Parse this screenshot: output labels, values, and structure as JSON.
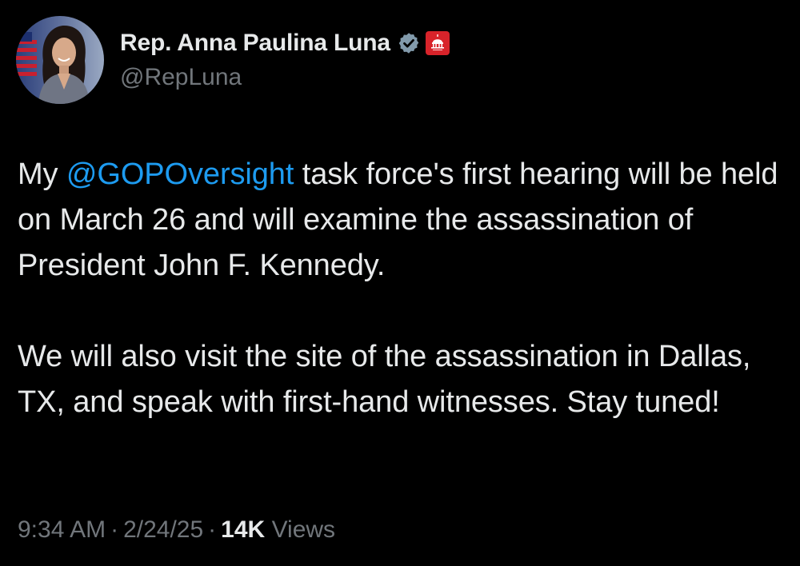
{
  "author": {
    "display_name": "Rep. Anna Paulina Luna",
    "handle": "@RepLuna",
    "verified_icon": "verified-check-icon",
    "affiliation_icon": "capitol-badge-icon",
    "affiliation_color": "#d8232a",
    "verified_color": "#829aab"
  },
  "tweet": {
    "p1_pre": "My ",
    "p1_mention": "@GOPOversight",
    "p1_post": " task force's first hearing will be held on March 26 and will examine the assassination of President John F. Kennedy.",
    "p2": "We will also visit the site of the assassination in Dallas, TX, and speak with first-hand witnesses. Stay tuned!"
  },
  "meta": {
    "time": "9:34 AM",
    "separator": "·",
    "date": "2/24/25",
    "views_count": "14K",
    "views_label": "Views"
  },
  "colors": {
    "background": "#000000",
    "text": "#e7e9ea",
    "secondary": "#71767b",
    "link": "#1d9bf0"
  }
}
